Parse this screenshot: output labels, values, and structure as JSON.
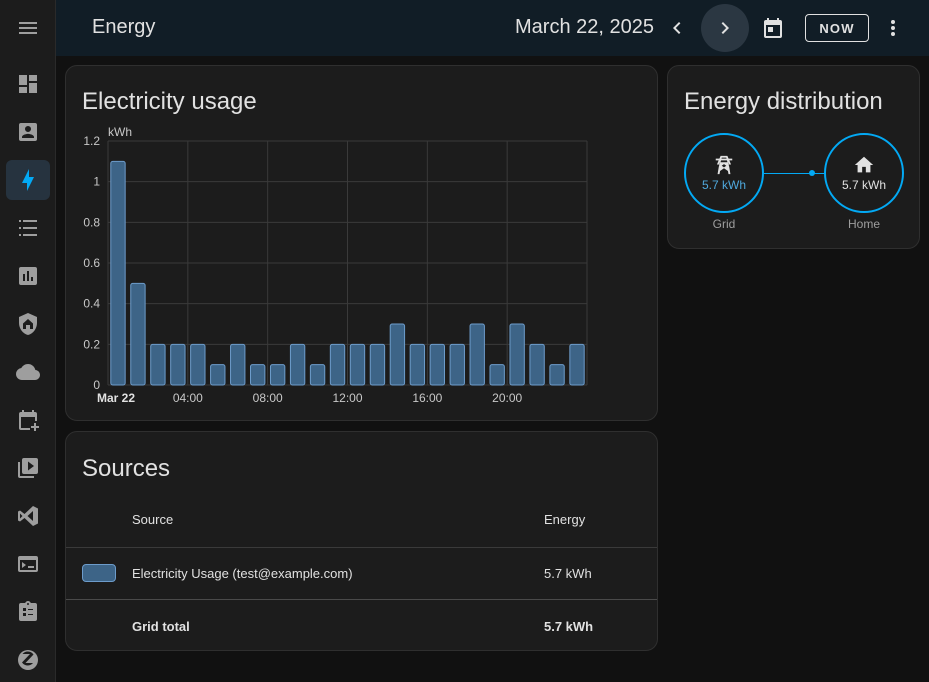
{
  "header": {
    "title": "Energy",
    "date": "March 22, 2025",
    "now_label": "NOW"
  },
  "sidebar": {
    "items": [
      {
        "icon": "dashboard-icon"
      },
      {
        "icon": "account-box-icon"
      },
      {
        "icon": "lightning-icon",
        "active": true
      },
      {
        "icon": "list-icon"
      },
      {
        "icon": "chart-icon"
      },
      {
        "icon": "shield-home-icon"
      },
      {
        "icon": "cloud-icon"
      },
      {
        "icon": "calendar-plus-icon"
      },
      {
        "icon": "media-icon"
      },
      {
        "icon": "vscode-icon"
      },
      {
        "icon": "terminal-icon"
      },
      {
        "icon": "clipboard-icon"
      },
      {
        "icon": "zigbee-icon"
      }
    ]
  },
  "usage_card": {
    "title": "Electricity usage"
  },
  "chart_data": {
    "type": "bar",
    "title": "Electricity usage",
    "ylabel": "kWh",
    "ylim": [
      0,
      1.2
    ],
    "yticks": [
      "0",
      "0.2",
      "0.4",
      "0.6",
      "0.8",
      "1",
      "1.2"
    ],
    "xticks": [
      "Mar 22",
      "04:00",
      "08:00",
      "12:00",
      "16:00",
      "20:00"
    ],
    "categories": [
      "00:00",
      "01:00",
      "02:00",
      "03:00",
      "04:00",
      "05:00",
      "06:00",
      "07:00",
      "08:00",
      "09:00",
      "10:00",
      "11:00",
      "12:00",
      "13:00",
      "14:00",
      "15:00",
      "16:00",
      "17:00",
      "18:00",
      "19:00",
      "20:00",
      "21:00",
      "22:00",
      "23:00"
    ],
    "series": [
      {
        "values": [
          1.1,
          0.5,
          0.2,
          0.2,
          0.2,
          0.1,
          0.2,
          0.1,
          0.1,
          0.2,
          0.1,
          0.2,
          0.2,
          0.2,
          0.3,
          0.2,
          0.2,
          0.2,
          0.3,
          0.1,
          0.3,
          0.2,
          0.1,
          0.2
        ]
      }
    ],
    "grid": true,
    "colors": {
      "bar_fill": "#3d6487",
      "bar_stroke": "#6d9ccb"
    }
  },
  "distribution": {
    "title": "Energy distribution",
    "grid": {
      "value": "5.7 kWh",
      "label": "Grid"
    },
    "home": {
      "value": "5.7 kWh",
      "label": "Home"
    }
  },
  "sources": {
    "title": "Sources",
    "col_source": "Source",
    "col_energy": "Energy",
    "rows": [
      {
        "name": "Electricity Usage (test@example.com)",
        "energy": "5.7 kWh"
      }
    ],
    "total_label": "Grid total",
    "total_value": "5.7 kWh"
  },
  "colors": {
    "accent": "#03a9f4",
    "header_bg": "#111d26",
    "card_bg": "#1c1c1c"
  }
}
